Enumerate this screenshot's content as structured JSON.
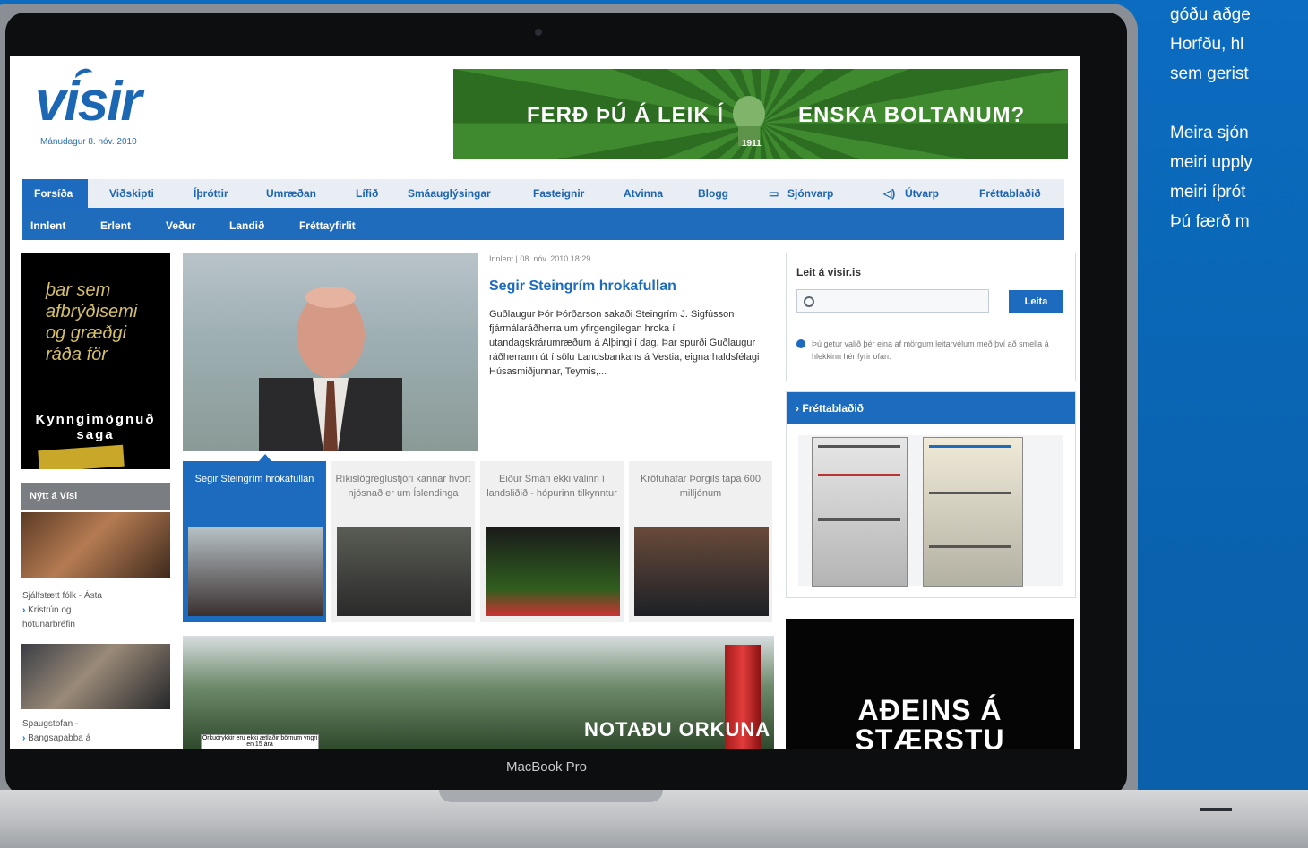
{
  "side_copy": {
    "lines_a": [
      "góðu aðge",
      "Horfðu, hl",
      "sem gerist"
    ],
    "lines_b": [
      "Meira sjón",
      "meiri upply",
      "meiri íþrót",
      "Þú færð m"
    ]
  },
  "laptop": {
    "brand_label": "MacBook Pro"
  },
  "site": {
    "logo": "visir",
    "date": "Mánudagur 8. nóv. 2010",
    "banner": {
      "left_text": "FERÐ ÞÚ Á LEIK Í",
      "right_text": "ENSKA BOLTANUM?"
    },
    "nav_primary": [
      "Forsíða",
      "Viðskipti",
      "Íþróttir",
      "Umræðan",
      "Lífið",
      "Smáauglýsingar",
      "Fasteignir",
      "Atvinna",
      "Blogg",
      "Sjónvarp",
      "Útvarp",
      "Fréttablaðið"
    ],
    "nav_secondary": [
      "Innlent",
      "Erlent",
      "Veður",
      "Landið",
      "Fréttayfirlit"
    ],
    "ad_left": {
      "lines": [
        "þar sem",
        "afbrýðisemi",
        "og græðgi",
        "ráða för"
      ],
      "bottom": [
        "Kynngimögnuð",
        "saga"
      ]
    },
    "nytt": {
      "title": "Nýtt á Vísi",
      "item1": {
        "line1": "Sjálfstætt fólk - Ásta",
        "line2": "Kristrún og",
        "line3": "hótunarbréfin"
      },
      "item2": {
        "line1": "Spaugstofan -",
        "line2": "Bangsapabba á"
      }
    },
    "article": {
      "meta": "Innlent | 08. nóv. 2010 18:29",
      "title": "Segir Steingrím hrokafullan",
      "body": "Guðlaugur Þór Þórðarson sakaði Steingrím J. Sigfússon fjármálaráðherra um yfirgengilegan hroka í utandagskrárumræðum á Alþingi í dag. Þar spurði Guðlaugur ráðherrann út í sölu Landsbankans á Vestia, eignarhaldsfélagi Húsasmiðjunnar, Teymis,..."
    },
    "thumbs": [
      {
        "caption": "Segir Steingrím hrokafullan"
      },
      {
        "caption": "Ríkislögreglustjóri kannar hvort njósnað er um Íslendinga"
      },
      {
        "caption": "Eiður Smári ekki valinn í landsliðið - hópurinn tilkynntur"
      },
      {
        "caption": "Kröfuhafar Þorgils tapa 600 milljónum"
      }
    ],
    "bottom_ad": {
      "text": "NOTAÐU ORKUNA",
      "note": "Orkudrykkir eru ekki ætlaðir börnum yngri en 15 ára"
    },
    "search": {
      "title": "Leit á visir.is",
      "placeholder": "",
      "button": "Leita",
      "info": "Þú getur valið þér eina af mörgum leitarvélum með því að smella á hlekkinn hér fyrir ofan."
    },
    "frettabladid": {
      "title": "› Fréttablaðið"
    },
    "dark_ad": {
      "line1": "AÐEINS Á",
      "line2": "STÆRSTU"
    }
  },
  "colors": {
    "brand_blue": "#1d6bbf",
    "page_blue": "#0a67b8"
  }
}
